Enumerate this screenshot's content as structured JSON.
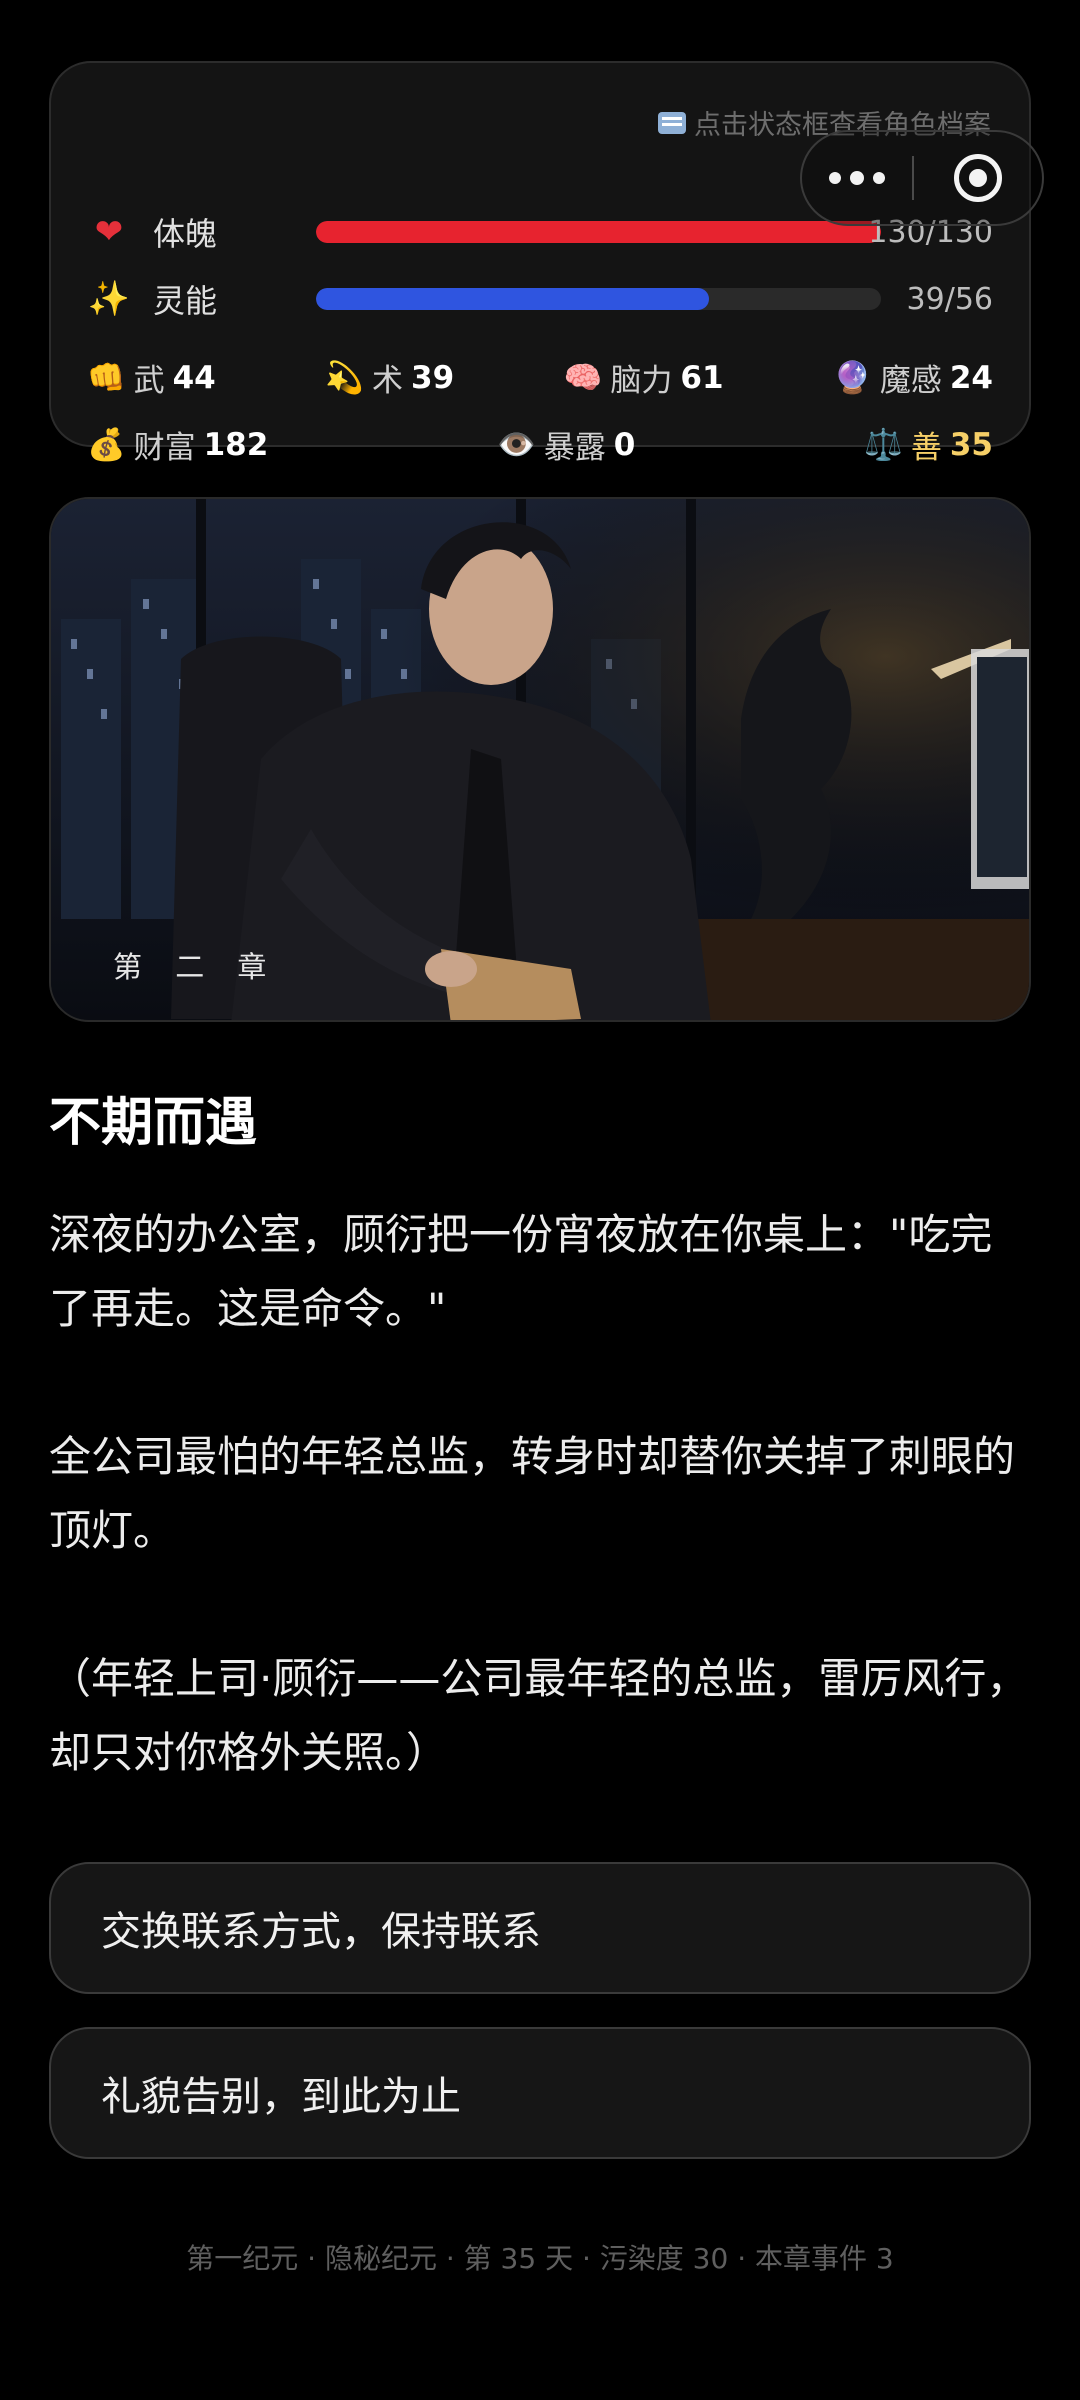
{
  "status": {
    "profile_hint": "点击状态框查看角色档案",
    "hp": {
      "label": "体魄",
      "current": 130,
      "max": 130,
      "text": "130/130",
      "icon": "heart-icon",
      "color": "#e7232f"
    },
    "mp": {
      "label": "灵能",
      "current": 39,
      "max": 56,
      "text": "39/56",
      "icon": "sparkles-icon",
      "color": "#2f55e0"
    },
    "attributes": [
      {
        "icon": "fist",
        "emoji": "👊",
        "name": "武",
        "value": "44"
      },
      {
        "icon": "dizzy-star",
        "emoji": "💫",
        "name": "术",
        "value": "39"
      },
      {
        "icon": "brain",
        "emoji": "🧠",
        "name": "脑力",
        "value": "61"
      },
      {
        "icon": "crystal-ball",
        "emoji": "🔮",
        "name": "魔感",
        "value": "24"
      },
      {
        "icon": "money-bag",
        "emoji": "💰",
        "name": "财富",
        "value": "182"
      },
      {
        "icon": "eye",
        "emoji": "👁️",
        "name": "暴露",
        "value": "0"
      },
      {
        "icon": "scales",
        "emoji": "⚖️",
        "name": "善",
        "value": "35",
        "color": "#f6cf67"
      }
    ]
  },
  "image": {
    "chapter_label": "第 二 章"
  },
  "story": {
    "title": "不期而遇",
    "paragraphs": [
      "深夜的办公室，顾衍把一份宵夜放在你桌上：\"吃完了再走。这是命令。\"",
      "全公司最怕的年轻总监，转身时却替你关掉了刺眼的顶灯。",
      "（年轻上司·顾衍——公司最年轻的总监，雷厉风行，却只对你格外关照。）"
    ]
  },
  "choices": [
    {
      "label": "交换联系方式，保持联系"
    },
    {
      "label": "礼貌告别，到此为止"
    }
  ],
  "footer": {
    "text": "第一纪元 · 隐秘纪元 · 第 35 天 · 污染度 30 · 本章事件 3"
  }
}
